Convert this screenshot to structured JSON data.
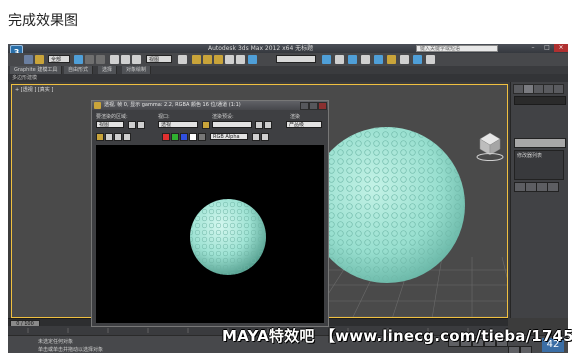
{
  "caption": "完成效果图",
  "app": {
    "title": "Autodesk 3ds Max  2012 x64    无标题",
    "search_placeholder": "键入关键字或短语",
    "toolbar": {
      "undo_dropdown": "全部",
      "view_dropdown": "视图",
      "selection_set_dropdown": ""
    },
    "ribbon": {
      "tabs": [
        "Graphite 建模工具",
        "自由形式",
        "选择",
        "对象绘制"
      ],
      "sub_label": "多边形建模"
    },
    "viewport": {
      "label": "+ [透视 ] [真实 ]"
    },
    "command_panel": {
      "list_label": "修改器列表"
    },
    "timeline": {
      "slider_label": "0 / 100"
    },
    "status": {
      "line1": "未选定任何对象",
      "line2": "单击或单击并拖动以选择对象",
      "frame_number": "42"
    },
    "colors": {
      "background": "#3c3c3c",
      "accent": "#3b6ea5",
      "selection_border": "#f0c040",
      "sphere": "#9fe3d4"
    }
  },
  "render_window": {
    "title": "透视, 帧 0, 显示 gamma: 2.2, RGBA 颜色 16 位/通道 (1:1)",
    "area_label": "要渲染的区域:",
    "area_value": "视图",
    "viewport_label": "视口:",
    "viewport_value": "透视",
    "preset_label": "渲染预设:",
    "preset_value": "",
    "render_label": "渲染",
    "render_value": "产品级",
    "channel_value": "RGB Alpha"
  },
  "watermark": "MAYA特效吧 【www.linecg.com/tieba/1745】"
}
